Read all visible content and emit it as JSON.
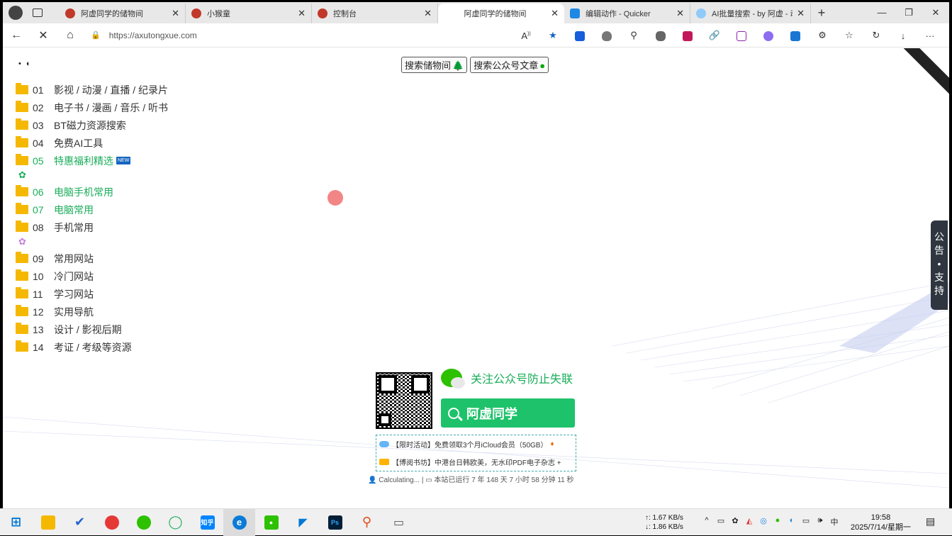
{
  "browser": {
    "tabs": [
      {
        "label": "阿虚同学的储物间",
        "color": "#c0392b",
        "active": false
      },
      {
        "label": "小猴童",
        "color": "#c0392b",
        "active": false
      },
      {
        "label": "控制台",
        "color": "#c0392b",
        "active": false
      },
      {
        "label": "阿虚同学的储物间",
        "color": "",
        "active": true
      },
      {
        "label": "编辑动作 - Quicker",
        "color": "#1e88e5",
        "active": false
      },
      {
        "label": "AI批量搜索 - by 阿虚 - 动",
        "color": "#1e88e5",
        "active": false
      }
    ],
    "new_tab": "+",
    "window_controls": [
      "—",
      "❐",
      "✕"
    ],
    "url": "https://axutongxue.com",
    "nav": {
      "back": "←",
      "stop": "✕",
      "home": "⌂"
    }
  },
  "page": {
    "eyes": "• ◐",
    "search_buttons": [
      {
        "label": "搜索储物间",
        "glyph": "🌲"
      },
      {
        "label": "搜索公众号文章",
        "glyph": "●"
      }
    ],
    "menu": [
      {
        "num": "01",
        "label": "影视 / 动漫 / 直播 / 纪录片",
        "green": false
      },
      {
        "num": "02",
        "label": "电子书 / 漫画 / 音乐 / 听书",
        "green": false
      },
      {
        "num": "03",
        "label": "BT磁力资源搜索",
        "green": false
      },
      {
        "num": "04",
        "label": "免费AI工具",
        "green": false
      },
      {
        "num": "05",
        "label": "特惠福利精选",
        "green": true,
        "badge": "NEW"
      },
      {
        "gear": "✿",
        "gear_color": "green"
      },
      {
        "num": "06",
        "label": "电脑手机常用",
        "green": true
      },
      {
        "num": "07",
        "label": "电脑常用",
        "green": true
      },
      {
        "num": "08",
        "label": "手机常用",
        "green": false
      },
      {
        "gear": "✿",
        "gear_color": "purple"
      },
      {
        "num": "09",
        "label": "常用网站",
        "green": false
      },
      {
        "num": "10",
        "label": "冷门网站",
        "green": false
      },
      {
        "num": "11",
        "label": "学习网站",
        "green": false
      },
      {
        "num": "12",
        "label": "实用导航",
        "green": false
      },
      {
        "num": "13",
        "label": "设计 / 影视后期",
        "green": false
      },
      {
        "num": "14",
        "label": "考证 / 考级等资源",
        "green": false
      }
    ],
    "notice_tab": [
      "公",
      "告",
      "•",
      "支",
      "持"
    ],
    "follow_text": "关注公众号防止失联",
    "wechat_search": "阿虚同学",
    "ads": [
      "【限时活动】免费领取3个月iCloud会员（50GB）",
      "【博阅书坊】中港台日韩欧美，无水印PDF电子杂志 +"
    ],
    "status": "👤 Calculating... | ▭ 本站已运行 7 年 148 天 7 小时 58 分钟 11 秒"
  },
  "taskbar": {
    "apps": [
      {
        "name": "windows",
        "color": "#0078d4",
        "text": "⊞"
      },
      {
        "name": "file-explorer",
        "color": "#f5b800",
        "text": ""
      },
      {
        "name": "todo",
        "color": "#2564cf",
        "text": "✔"
      },
      {
        "name": "app-3",
        "color": "#e53935",
        "text": ""
      },
      {
        "name": "app-4",
        "color": "#2dc100",
        "text": ""
      },
      {
        "name": "app-5",
        "color": "#1aad5a",
        "text": "◯"
      },
      {
        "name": "zhihu",
        "color": "#0084ff",
        "text": "知乎"
      },
      {
        "name": "edge",
        "color": "#0c7bd8",
        "text": "e"
      },
      {
        "name": "wechat",
        "color": "#2dc100",
        "text": "●"
      },
      {
        "name": "vscode",
        "color": "#0078d4",
        "text": "◤"
      },
      {
        "name": "photoshop",
        "color": "#001e36",
        "text": "Ps"
      },
      {
        "name": "search-tool",
        "color": "#e64a19",
        "text": "⚲"
      },
      {
        "name": "screen-tool",
        "color": "#555",
        "text": "▭"
      }
    ],
    "net_up": "↑: 1.67 KB/s",
    "net_down": "↓: 1.86 KB/s",
    "tray": [
      "^",
      "▭",
      "✿",
      "◭",
      "◎",
      "●",
      "◐",
      "▭",
      "🕪",
      "中"
    ],
    "time": "19:58",
    "date": "2025/7/14/星期一",
    "notif": "▤"
  }
}
